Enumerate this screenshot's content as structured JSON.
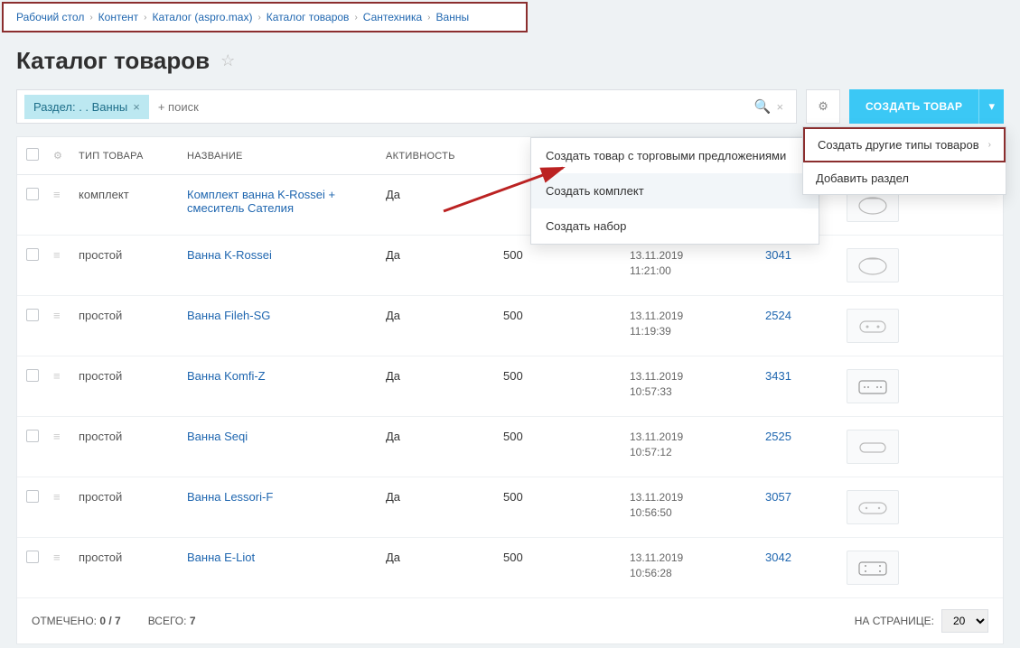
{
  "breadcrumb": [
    "Рабочий стол",
    "Контент",
    "Каталог (aspro.max)",
    "Каталог товаров",
    "Сантехника",
    "Ванны"
  ],
  "page_title": "Каталог товаров",
  "filter_chip": "Раздел: . . Ванны",
  "search_placeholder": "+ поиск",
  "create_button": "СОЗДАТЬ ТОВАР",
  "columns": {
    "type": "ТИП ТОВАРА",
    "name": "НАЗВАНИЕ",
    "active": "АКТИВНОСТЬ"
  },
  "context_menu": {
    "item1": "Создать товар с торговыми предложениями",
    "item2": "Создать комплект",
    "item3": "Создать набор"
  },
  "side_menu": {
    "item1": "Создать другие типы товаров",
    "item2": "Добавить раздел"
  },
  "rows": [
    {
      "type": "комплект",
      "name": "Комплект ванна K-Rossei + смеситель Сателия",
      "active": "Да",
      "qty": "",
      "date": "",
      "id": ""
    },
    {
      "type": "простой",
      "name": "Ванна K-Rossei",
      "active": "Да",
      "qty": "500",
      "date": "13.11.2019 11:21:00",
      "id": "3041"
    },
    {
      "type": "простой",
      "name": "Ванна Fileh-SG",
      "active": "Да",
      "qty": "500",
      "date": "13.11.2019 11:19:39",
      "id": "2524"
    },
    {
      "type": "простой",
      "name": "Ванна Komfi-Z",
      "active": "Да",
      "qty": "500",
      "date": "13.11.2019 10:57:33",
      "id": "3431"
    },
    {
      "type": "простой",
      "name": "Ванна Seqi",
      "active": "Да",
      "qty": "500",
      "date": "13.11.2019 10:57:12",
      "id": "2525"
    },
    {
      "type": "простой",
      "name": "Ванна Lessori-F",
      "active": "Да",
      "qty": "500",
      "date": "13.11.2019 10:56:50",
      "id": "3057"
    },
    {
      "type": "простой",
      "name": "Ванна E-Liot",
      "active": "Да",
      "qty": "500",
      "date": "13.11.2019 10:56:28",
      "id": "3042"
    }
  ],
  "footer": {
    "selected_label": "ОТМЕЧЕНО:",
    "selected_value": "0 / 7",
    "total_label": "ВСЕГО:",
    "total_value": "7",
    "page_label": "НА СТРАНИЦЕ:",
    "page_value": "20"
  }
}
